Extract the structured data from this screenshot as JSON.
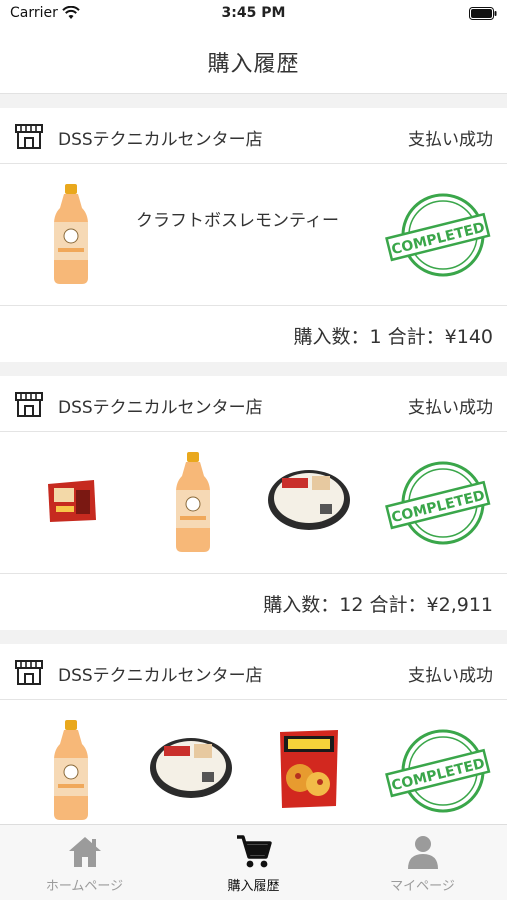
{
  "status_bar": {
    "carrier": "Carrier",
    "time": "3:45 PM"
  },
  "header": {
    "title": "購入履歴"
  },
  "orders": [
    {
      "store": "DSSテクニカルセンター店",
      "status": "支払い成功",
      "product_name": "クラフトボスレモンティー",
      "items": [
        "lemon-tea-bottle"
      ],
      "summary": "購入数：1 合計：¥140",
      "stamp": "COMPLETED"
    },
    {
      "store": "DSSテクニカルセンター店",
      "status": "支払い成功",
      "items": [
        "snack-bag",
        "lemon-tea-bottle",
        "udon-bowl"
      ],
      "summary": "購入数：12 合計：¥2,911",
      "stamp": "COMPLETED"
    },
    {
      "store": "DSSテクニカルセンター店",
      "status": "支払い成功",
      "items": [
        "lemon-tea-bottle",
        "udon-bowl",
        "pizza-potato-chips"
      ],
      "stamp": "COMPLETED"
    }
  ],
  "tab_bar": {
    "items": [
      {
        "label": "ホームページ",
        "icon": "home-icon",
        "active": false
      },
      {
        "label": "購入履歴",
        "icon": "cart-icon",
        "active": true
      },
      {
        "label": "マイページ",
        "icon": "user-icon",
        "active": false
      }
    ]
  },
  "colors": {
    "stamp_green": "#3aa64a",
    "active_tab": "#111111",
    "inactive_tab": "#9b9b9b"
  }
}
